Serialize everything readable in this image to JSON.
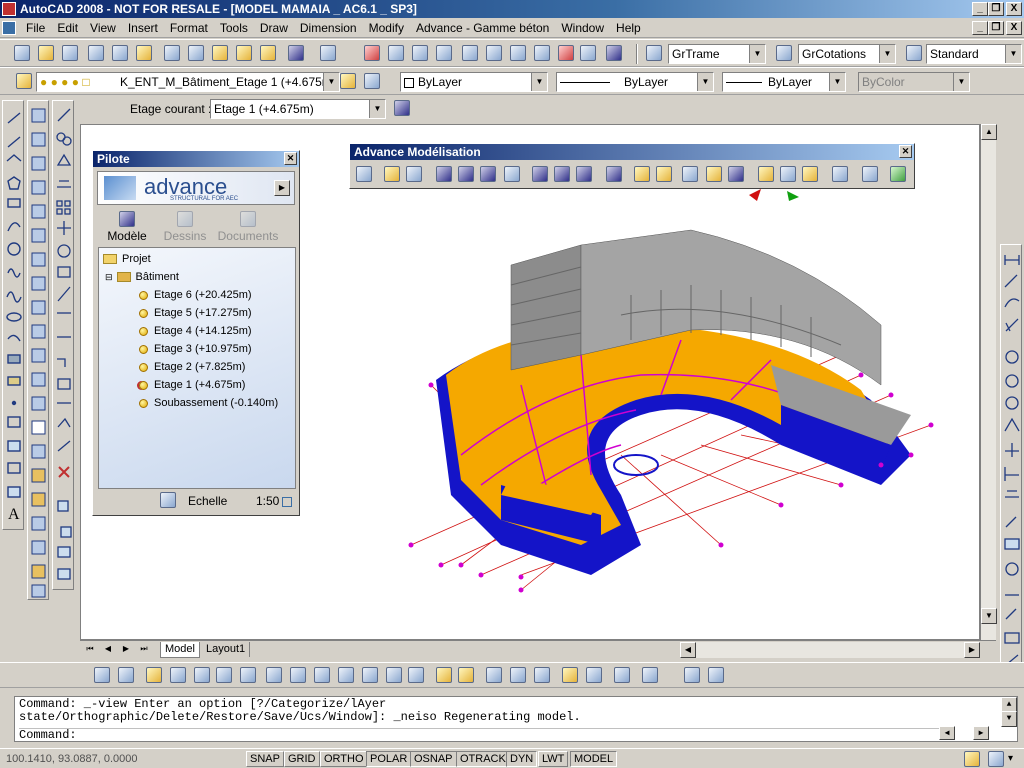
{
  "window": {
    "title": "AutoCAD 2008 - NOT FOR RESALE - [MODEL MAMAIA _ AC6.1 _ SP3]",
    "buttons": [
      "_",
      "❐",
      "X"
    ]
  },
  "menu": [
    "File",
    "Edit",
    "View",
    "Insert",
    "Format",
    "Tools",
    "Draw",
    "Dimension",
    "Modify",
    "Advance - Gamme béton",
    "Window",
    "Help"
  ],
  "styles": {
    "text_style": "GrTrame",
    "dim_style": "GrCotations",
    "table_style": "Standard"
  },
  "layers": {
    "current": "K_ENT_M_Bâtiment_Etage 1 (+4.675m)",
    "color": "ByLayer",
    "linetype": "ByLayer",
    "lineweight": "ByLayer",
    "plotstyle": "ByColor"
  },
  "etage": {
    "label": "Etage courant :",
    "value": "Etage 1 (+4.675m)"
  },
  "pilote": {
    "title": "Pilote",
    "logo": "advance",
    "logo_sub": "STRUCTURAL FOR AEC",
    "tabs": [
      "Modèle",
      "Dessins",
      "Documents"
    ],
    "tree": {
      "projet": "Projet",
      "batiment": "Bâtiment",
      "etages": [
        "Etage 6 (+20.425m)",
        "Etage 5 (+17.275m)",
        "Etage 4 (+14.125m)",
        "Etage 3 (+10.975m)",
        "Etage 2 (+7.825m)",
        "Etage 1 (+4.675m)",
        "Soubassement (-0.140m)"
      ]
    },
    "scale_label": "Echelle",
    "scale_value": "1:50"
  },
  "adv_toolbar": {
    "title": "Advance Modélisation"
  },
  "tabs": [
    "Model",
    "Layout1"
  ],
  "command": {
    "line1": "Command: _-view Enter an option [?/Categorize/lAyer",
    "line2": "state/Orthographic/Delete/Restore/Save/Ucs/Window]: _neiso Regenerating model.",
    "prompt": "Command:"
  },
  "status": {
    "coords": "100.1410, 93.0887, 0.0000",
    "toggles": [
      "SNAP",
      "GRID",
      "ORTHO",
      "POLAR",
      "OSNAP",
      "OTRACK",
      "DYN",
      "LWT",
      "MODEL"
    ]
  },
  "colors": {
    "slab": "#f5a800",
    "structure": "#1414c8",
    "walls": "#9a9a9a",
    "beams": "#d000d0",
    "grid": "#d01010"
  }
}
